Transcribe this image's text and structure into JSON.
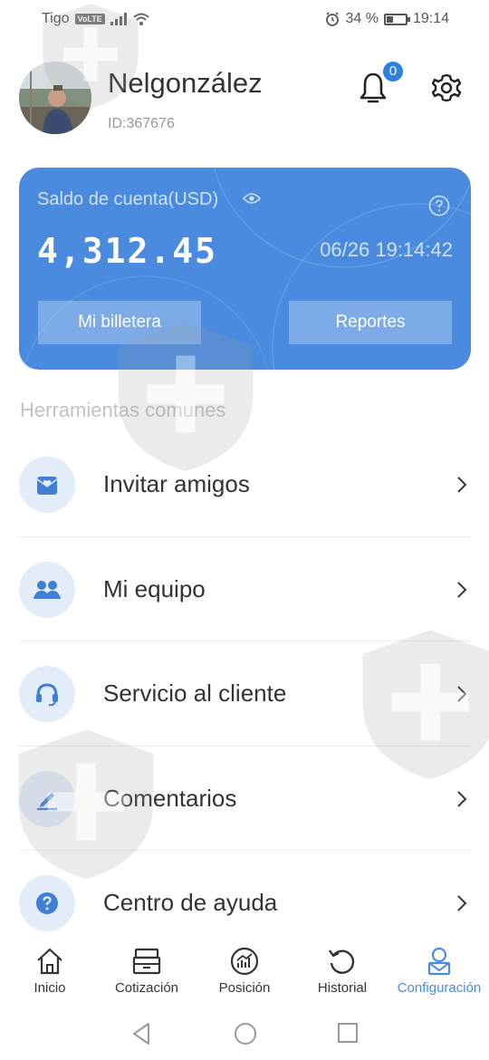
{
  "status_bar": {
    "carrier": "Tigo",
    "volte": "VoLTE",
    "battery_percent": "34 %",
    "battery_level": 0.34,
    "time": "19:14"
  },
  "profile": {
    "name": "Nelgonzález",
    "id": "ID:367676",
    "notifications": "0"
  },
  "account_card": {
    "label": "Saldo de cuenta(USD)",
    "balance": "4,312.45",
    "timestamp": "06/26 19:14:42",
    "wallet_button": "Mi billetera",
    "reports_button": "Reportes"
  },
  "tools": {
    "title": "Herramientas comunes",
    "items": [
      {
        "label": "Invitar amigos",
        "icon": "invite-icon"
      },
      {
        "label": "Mi equipo",
        "icon": "team-icon"
      },
      {
        "label": "Servicio al cliente",
        "icon": "headset-icon"
      },
      {
        "label": "Comentarios",
        "icon": "pencil-icon"
      },
      {
        "label": "Centro de ayuda",
        "icon": "help-circle-icon"
      }
    ]
  },
  "bottom_nav": {
    "items": [
      {
        "label": "Inicio",
        "icon": "home-icon"
      },
      {
        "label": "Cotización",
        "icon": "register-icon"
      },
      {
        "label": "Posición",
        "icon": "chart-icon"
      },
      {
        "label": "Historial",
        "icon": "history-icon"
      },
      {
        "label": "Configuración",
        "icon": "profile-icon"
      }
    ],
    "active": "Configuración"
  },
  "colors": {
    "accent": "#4a8bdf",
    "icon_bg": "#e3ecf9",
    "icon_fg": "#3f7fd6"
  }
}
